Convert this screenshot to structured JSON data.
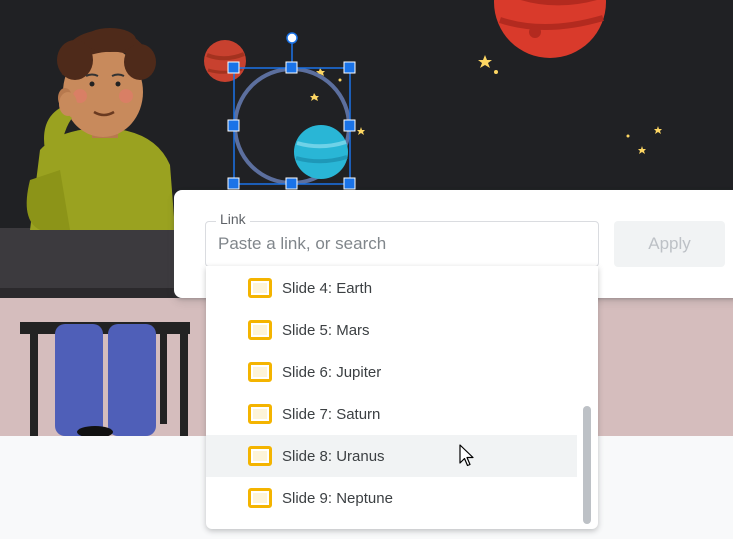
{
  "link_dialog": {
    "field_label": "Link",
    "input_value": "",
    "input_placeholder": "Paste a link, or search",
    "apply_label": "Apply"
  },
  "suggestions": [
    {
      "label": "Slide 4: Earth",
      "icon": "slide-icon"
    },
    {
      "label": "Slide 5: Mars",
      "icon": "slide-icon"
    },
    {
      "label": "Slide 6: Jupiter",
      "icon": "slide-icon"
    },
    {
      "label": "Slide 7: Saturn",
      "icon": "slide-icon"
    },
    {
      "label": "Slide 8: Uranus",
      "icon": "slide-icon",
      "hovered": true
    },
    {
      "label": "Slide 9: Neptune",
      "icon": "slide-icon"
    }
  ],
  "colors": {
    "accent": "#1a73e8",
    "slide_icon": "#f4b400",
    "slide_background": "#202124",
    "hover_row": "#f1f3f4"
  }
}
